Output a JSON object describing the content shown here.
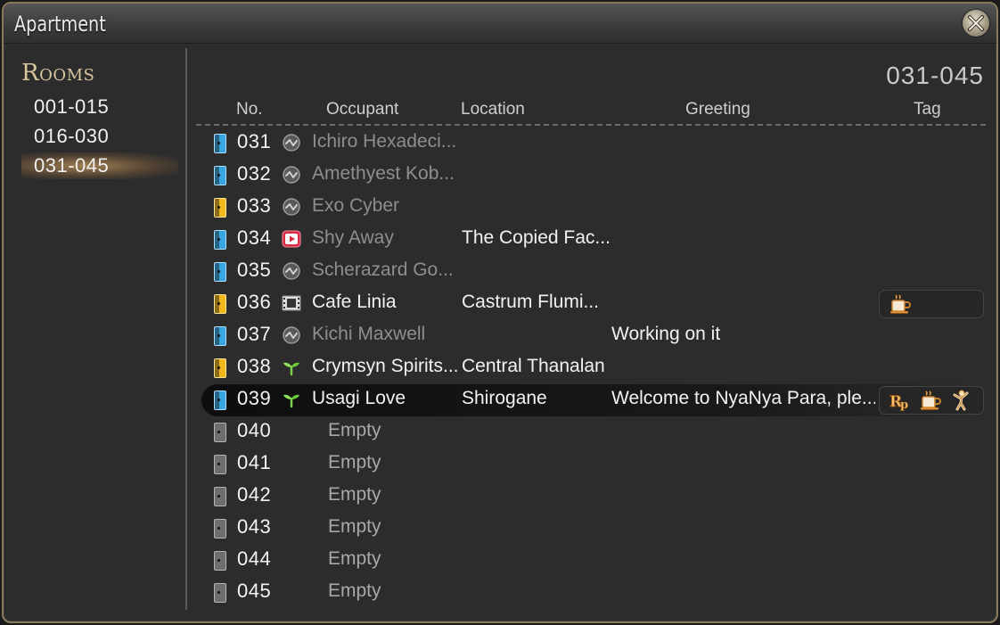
{
  "window": {
    "title": "Apartment"
  },
  "sidebar": {
    "title": "Rooms",
    "ranges": [
      {
        "label": "001-015",
        "selected": false
      },
      {
        "label": "016-030",
        "selected": false
      },
      {
        "label": "031-045",
        "selected": true
      }
    ]
  },
  "main": {
    "page_label": "031-045",
    "columns": {
      "no": "No.",
      "occupant": "Occupant",
      "location": "Location",
      "greeting": "Greeting",
      "tag": "Tag"
    },
    "rows": [
      {
        "no": "031",
        "door": "blue",
        "status_icon": "offline-icon",
        "occupant": "Ichiro Hexadeci...",
        "occupant_dim": true,
        "location": "",
        "greeting": "",
        "tags": []
      },
      {
        "no": "032",
        "door": "blue",
        "status_icon": "offline-icon",
        "occupant": "Amethyest Kob...",
        "occupant_dim": true,
        "location": "",
        "greeting": "",
        "tags": []
      },
      {
        "no": "033",
        "door": "yellow",
        "status_icon": "offline-icon",
        "occupant": "Exo Cyber",
        "occupant_dim": true,
        "location": "",
        "greeting": "",
        "tags": []
      },
      {
        "no": "034",
        "door": "blue",
        "status_icon": "viewing-cutscene-icon",
        "occupant": "Shy Away",
        "occupant_dim": true,
        "location": "The Copied Fac...",
        "greeting": "",
        "tags": []
      },
      {
        "no": "035",
        "door": "blue",
        "status_icon": "offline-icon",
        "occupant": "Scherazard Go...",
        "occupant_dim": true,
        "location": "",
        "greeting": "",
        "tags": []
      },
      {
        "no": "036",
        "door": "yellow",
        "status_icon": "film-icon",
        "occupant": "Cafe Linia",
        "occupant_dim": false,
        "location": "Castrum Flumi...",
        "greeting": "",
        "tags": [
          "cafe-icon"
        ]
      },
      {
        "no": "037",
        "door": "blue",
        "status_icon": "offline-icon",
        "occupant": "Kichi Maxwell",
        "occupant_dim": true,
        "location": "",
        "greeting": "Working on it",
        "tags": []
      },
      {
        "no": "038",
        "door": "yellow",
        "status_icon": "sprout-icon",
        "occupant": "Crymsyn Spirits...",
        "occupant_dim": false,
        "location": "Central Thanalan",
        "greeting": "",
        "tags": []
      },
      {
        "no": "039",
        "door": "blue",
        "status_icon": "sprout-icon",
        "occupant": "Usagi Love",
        "occupant_dim": false,
        "location": "Shirogane",
        "greeting": "Welcome to NyaNya Para, ple...",
        "tags": [
          "roleplay-icon",
          "cafe-icon",
          "dance-icon"
        ],
        "highlight": true
      },
      {
        "no": "040",
        "door": "empty",
        "occupant": "Empty",
        "empty": true
      },
      {
        "no": "041",
        "door": "empty",
        "occupant": "Empty",
        "empty": true
      },
      {
        "no": "042",
        "door": "empty",
        "occupant": "Empty",
        "empty": true
      },
      {
        "no": "043",
        "door": "empty",
        "occupant": "Empty",
        "empty": true
      },
      {
        "no": "044",
        "door": "empty",
        "occupant": "Empty",
        "empty": true
      },
      {
        "no": "045",
        "door": "empty",
        "occupant": "Empty",
        "empty": true
      }
    ]
  }
}
